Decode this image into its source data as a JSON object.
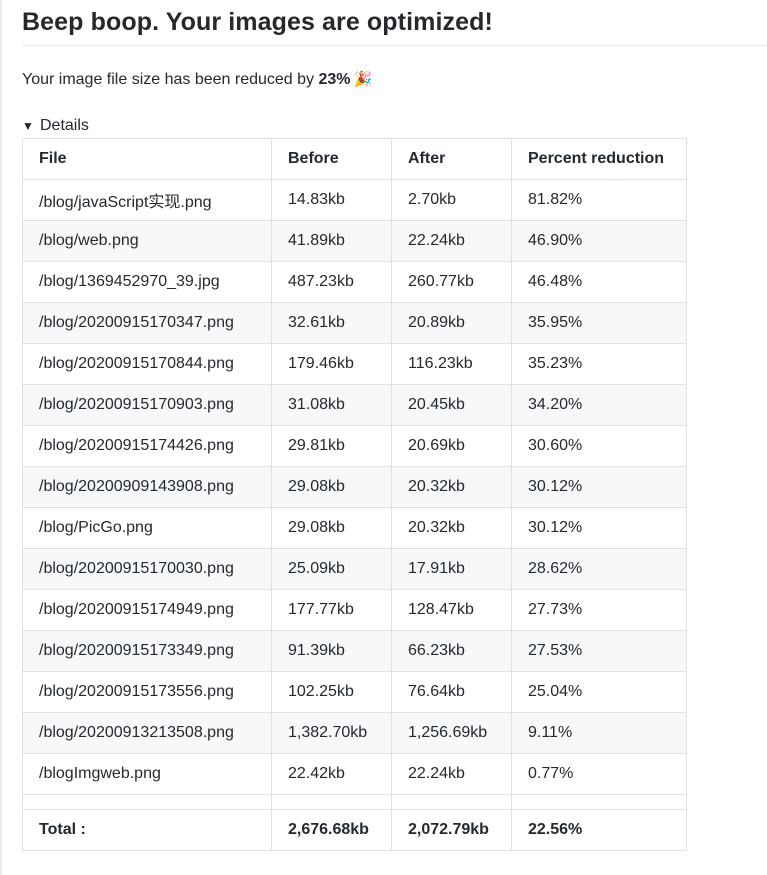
{
  "heading": "Beep boop. Your images are optimized!",
  "summary": {
    "prefix": "Your image file size has been reduced by ",
    "percent": "23%",
    "emoji": "🎉"
  },
  "details_label": "Details",
  "table": {
    "headers": [
      "File",
      "Before",
      "After",
      "Percent reduction"
    ],
    "rows": [
      [
        "/blog/javaScript实现.png",
        "14.83kb",
        "2.70kb",
        "81.82%"
      ],
      [
        "/blog/web.png",
        "41.89kb",
        "22.24kb",
        "46.90%"
      ],
      [
        "/blog/1369452970_39.jpg",
        "487.23kb",
        "260.77kb",
        "46.48%"
      ],
      [
        "/blog/20200915170347.png",
        "32.61kb",
        "20.89kb",
        "35.95%"
      ],
      [
        "/blog/20200915170844.png",
        "179.46kb",
        "116.23kb",
        "35.23%"
      ],
      [
        "/blog/20200915170903.png",
        "31.08kb",
        "20.45kb",
        "34.20%"
      ],
      [
        "/blog/20200915174426.png",
        "29.81kb",
        "20.69kb",
        "30.60%"
      ],
      [
        "/blog/20200909143908.png",
        "29.08kb",
        "20.32kb",
        "30.12%"
      ],
      [
        "/blog/PicGo.png",
        "29.08kb",
        "20.32kb",
        "30.12%"
      ],
      [
        "/blog/20200915170030.png",
        "25.09kb",
        "17.91kb",
        "28.62%"
      ],
      [
        "/blog/20200915174949.png",
        "177.77kb",
        "128.47kb",
        "27.73%"
      ],
      [
        "/blog/20200915173349.png",
        "91.39kb",
        "66.23kb",
        "27.53%"
      ],
      [
        "/blog/20200915173556.png",
        "102.25kb",
        "76.64kb",
        "25.04%"
      ],
      [
        "/blog/20200913213508.png",
        "1,382.70kb",
        "1,256.69kb",
        "9.11%"
      ],
      [
        "/blogImgweb.png",
        "22.42kb",
        "22.24kb",
        "0.77%"
      ]
    ],
    "total": [
      "Total :",
      "2,676.68kb",
      "2,072.79kb",
      "22.56%"
    ]
  }
}
